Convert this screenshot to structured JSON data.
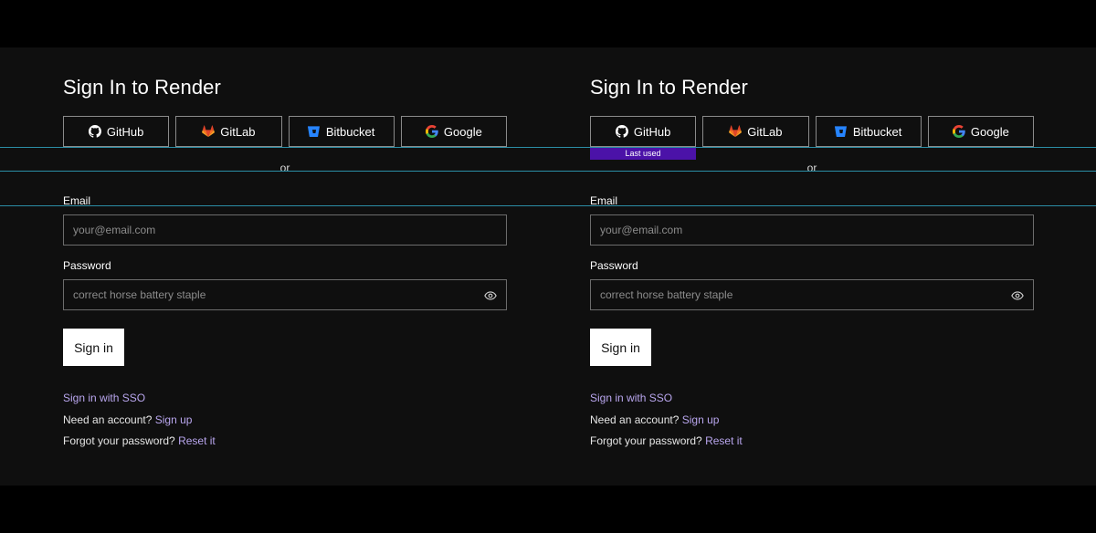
{
  "page_title": "Sign In to Render",
  "oauth": [
    {
      "label": "GitHub",
      "icon": "github-icon"
    },
    {
      "label": "GitLab",
      "icon": "gitlab-icon"
    },
    {
      "label": "Bitbucket",
      "icon": "bitbucket-icon"
    },
    {
      "label": "Google",
      "icon": "google-icon"
    }
  ],
  "last_used_badge": "Last used",
  "divider_text": "or",
  "email": {
    "label": "Email",
    "placeholder": "your@email.com",
    "value": ""
  },
  "password": {
    "label": "Password",
    "placeholder": "correct horse battery staple",
    "value": "",
    "toggle_icon": "eye-icon"
  },
  "submit_label": "Sign in",
  "sso_link": "Sign in with SSO",
  "signup": {
    "prompt": "Need an account?",
    "link": "Sign up"
  },
  "reset": {
    "prompt": "Forgot your password?",
    "link": "Reset it"
  },
  "colors": {
    "page_background": "#000000",
    "panel_background": "#0f0f0f",
    "link": "#b9a6ee",
    "badge": "#4b12a8",
    "guide_line": "#2b8ea6"
  }
}
